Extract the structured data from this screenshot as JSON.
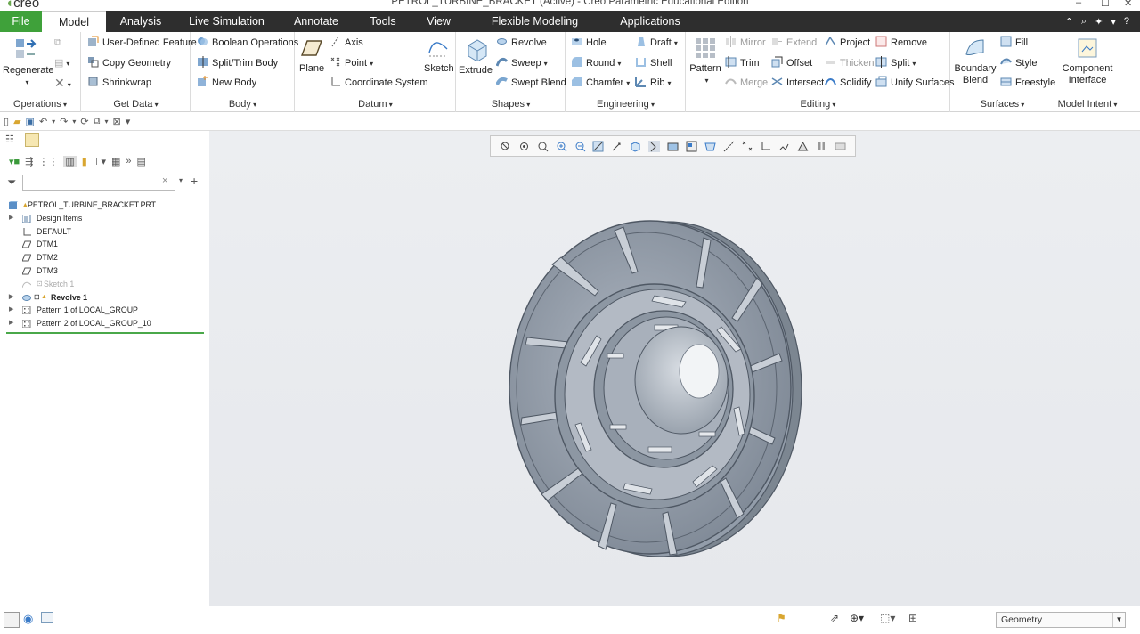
{
  "window": {
    "app_logo": "creo",
    "title": "PETROL_TURBINE_BRACKET (Active) - Creo Parametric Educational Edition",
    "controls": [
      "–",
      "☐",
      "✕"
    ]
  },
  "tabs": [
    "File",
    "Model",
    "Analysis",
    "Live Simulation",
    "Annotate",
    "Tools",
    "View",
    "Flexible Modeling",
    "Applications"
  ],
  "active_tab": "Model",
  "ribbon": {
    "operations": {
      "label": "Operations",
      "regenerate": "Regenerate"
    },
    "get_data": {
      "label": "Get Data",
      "items": [
        "User-Defined Feature",
        "Copy Geometry",
        "Shrinkwrap"
      ]
    },
    "body": {
      "label": "Body",
      "items": [
        "Boolean Operations",
        "Split/Trim Body",
        "New Body"
      ]
    },
    "datum": {
      "label": "Datum",
      "plane": "Plane",
      "axis": "Axis",
      "point": "Point",
      "csys": "Coordinate System",
      "sketch": "Sketch"
    },
    "shapes": {
      "label": "Shapes",
      "extrude": "Extrude",
      "revolve": "Revolve",
      "sweep": "Sweep",
      "swept_blend": "Swept Blend"
    },
    "engineering": {
      "label": "Engineering",
      "hole": "Hole",
      "round": "Round",
      "chamfer": "Chamfer",
      "draft": "Draft",
      "shell": "Shell",
      "rib": "Rib"
    },
    "editing": {
      "label": "Editing",
      "pattern": "Pattern",
      "mirror": "Mirror",
      "trim": "Trim",
      "merge": "Merge",
      "extend": "Extend",
      "offset": "Offset",
      "intersect": "Intersect",
      "project": "Project",
      "thicken": "Thicken",
      "solidify": "Solidify",
      "remove": "Remove",
      "split": "Split",
      "unify_surfaces": "Unify Surfaces"
    },
    "surfaces": {
      "label": "Surfaces",
      "boundary_blend": "Boundary Blend",
      "fill": "Fill",
      "style": "Style",
      "freestyle": "Freestyle"
    },
    "model_intent": {
      "label": "Model Intent",
      "component_interface": "Component Interface"
    }
  },
  "model_tree": {
    "filter_placeholder": "",
    "items": [
      {
        "label": "PETROL_TURBINE_BRACKET.PRT",
        "indent": 0
      },
      {
        "label": "Design Items",
        "indent": 1,
        "expand": true
      },
      {
        "label": "DEFAULT",
        "indent": 1
      },
      {
        "label": "DTM1",
        "indent": 1
      },
      {
        "label": "DTM2",
        "indent": 1
      },
      {
        "label": "DTM3",
        "indent": 1
      },
      {
        "label": "Sketch 1",
        "indent": 1,
        "greyed": true
      },
      {
        "label": "Revolve 1",
        "indent": 1,
        "bold": true,
        "expand": true
      },
      {
        "label": "Pattern 1 of LOCAL_GROUP",
        "indent": 1,
        "expand": true
      },
      {
        "label": "Pattern 2 of LOCAL_GROUP_10",
        "indent": 1,
        "expand": true
      }
    ]
  },
  "statusbar": {
    "selection_filter": "Geometry"
  },
  "colors": {
    "file_tab": "#3fa13a",
    "tab_bar": "#2e2e2e",
    "model_fill": "#9aa3ae",
    "model_edge": "#4f5864"
  }
}
